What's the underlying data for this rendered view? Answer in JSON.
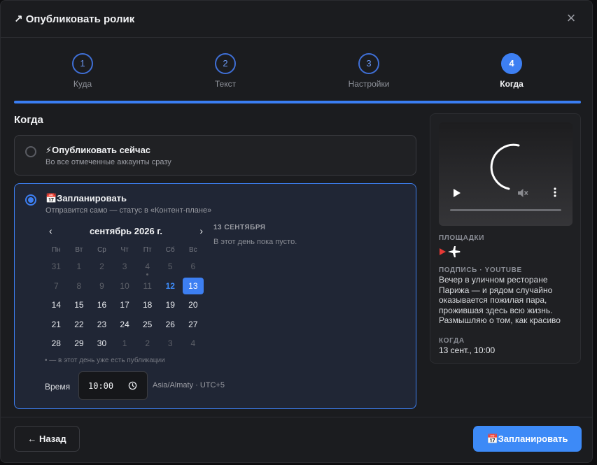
{
  "header": {
    "icon": "arrow-up-right-icon",
    "title": "↗ Опубликовать ролик",
    "close": "×"
  },
  "steps": [
    {
      "num": "1",
      "label": "Куда",
      "active": false
    },
    {
      "num": "2",
      "label": "Текст",
      "active": false
    },
    {
      "num": "3",
      "label": "Настройки",
      "active": false
    },
    {
      "num": "4",
      "label": "Когда",
      "active": true
    }
  ],
  "section_title": "Когда",
  "option_now": {
    "title": "⚡Опубликовать сейчас",
    "subtitle": "Во все отмеченные аккаунты сразу",
    "selected": false
  },
  "option_schedule": {
    "title": "📅Запланировать",
    "subtitle": "Отправится само — статус в «Контент-плане»",
    "selected": true
  },
  "calendar": {
    "prev": "‹",
    "next": "›",
    "month": "сентябрь 2026 г.",
    "weekdays": [
      "Пн",
      "Вт",
      "Ср",
      "Чт",
      "Пт",
      "Сб",
      "Вс"
    ],
    "weeks": [
      [
        "31",
        "1",
        "2",
        "3",
        "4",
        "5",
        "6"
      ],
      [
        "7",
        "8",
        "9",
        "10",
        "11",
        "12",
        "13"
      ],
      [
        "14",
        "15",
        "16",
        "17",
        "18",
        "19",
        "20"
      ],
      [
        "21",
        "22",
        "23",
        "24",
        "25",
        "26",
        "27"
      ],
      [
        "28",
        "29",
        "30",
        "1",
        "2",
        "3",
        "4"
      ]
    ],
    "muted_before": [
      "1",
      "2",
      "3",
      "4",
      "5",
      "6",
      "7",
      "8",
      "9",
      "10",
      "11"
    ],
    "today": "12",
    "selected": "13",
    "dot_day": "4",
    "legend": "• — в этот день уже есть публикации"
  },
  "day_panel": {
    "title": "13 СЕНТЯБРЯ",
    "empty": "В этот день пока пусто."
  },
  "time": {
    "label": "Время",
    "value": "10:00",
    "timezone": "Asia/Almaty · UTC+5"
  },
  "preview": {
    "platforms_label": "ПЛОЩАДКИ",
    "platform_icons": [
      "youtube-icon",
      "telegram-icon"
    ],
    "caption_label": "ПОДПИСЬ · YOUTUBE",
    "caption": "Вечер в уличном ресторане Парижа — и рядом случайно оказывается пожилая пара, прожившая здесь всю жизнь. Размышляю о том, как красиво стареть в этом городе и что",
    "when_label": "КОГДА",
    "when_value": "13 сент., 10:00"
  },
  "footer": {
    "back": "← Назад",
    "submit": "📅Запланировать"
  },
  "colors": {
    "accent": "#3d7ff2",
    "background": "#1b1c1f",
    "youtube": "#e53935"
  }
}
